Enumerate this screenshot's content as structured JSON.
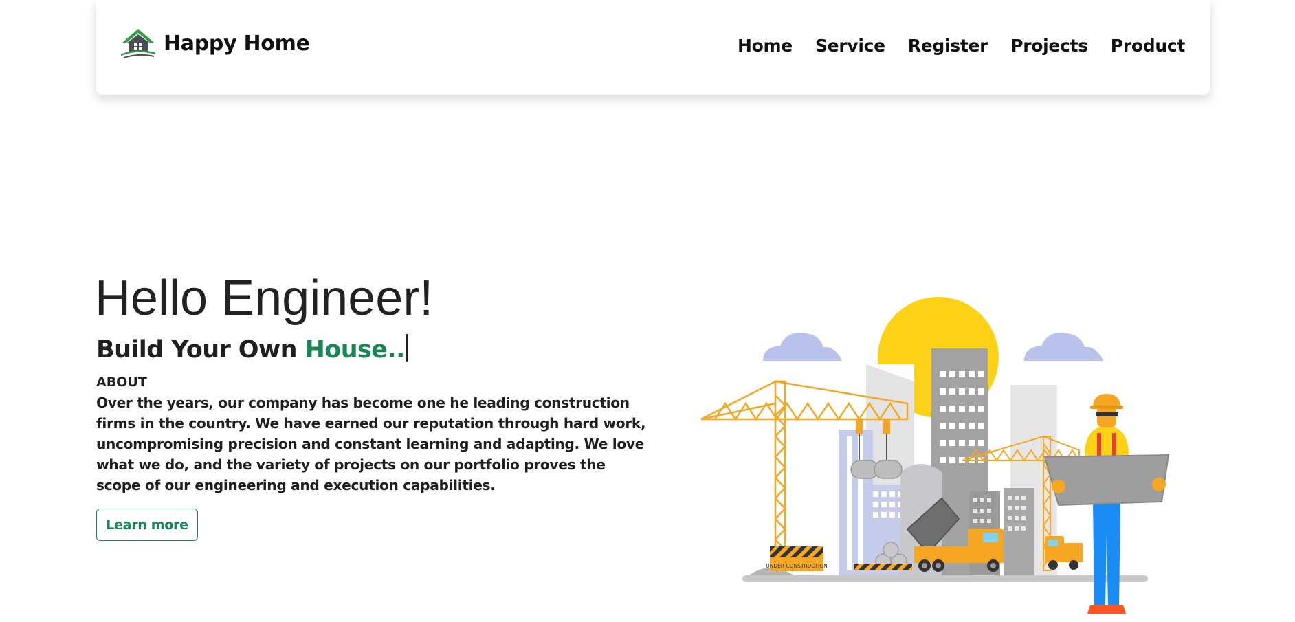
{
  "header": {
    "brand_name": "Happy Home",
    "brand_logo_icon": "house-logo-icon",
    "nav": [
      "Home",
      "Service",
      "Register",
      "Projects",
      "Product"
    ]
  },
  "hero": {
    "title": "Hello Engineer!",
    "subtitle_prefix": "Build Your Own ",
    "subtitle_accent": "House..",
    "about_label": "ABOUT",
    "about_text": "Over the years, our company has become one he leading construction firms in the country. We have earned our reputation through hard work, uncompromising precision and constant learning and adapting. We love what we do, and the variety of projects on our portfolio proves the scope of our engineering and execution capabilities.",
    "button_label": "Learn more",
    "illustration_sign_text": "UNDER CONSTRUCTION"
  },
  "colors": {
    "accent": "#198754",
    "crane": "#f5a623",
    "sun": "#fcd116",
    "cloud": "#b8c2ea",
    "building": "#9a9a9a"
  }
}
